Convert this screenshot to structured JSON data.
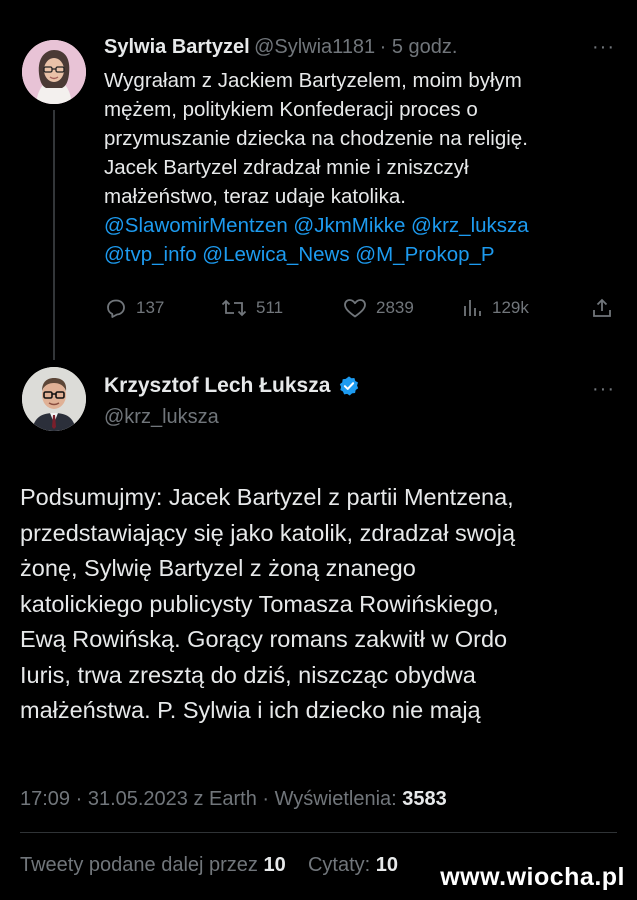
{
  "tweet1": {
    "author_name": "Sylwia Bartyzel",
    "author_handle": "@Sylwia1181",
    "time": "· 5 godz.",
    "more": "···",
    "lines": [
      "Wygrałam z Jackiem Bartyzelem, moim byłym",
      "mężem, politykiem Konfederacji proces o",
      "przymuszanie dziecka na chodzenie na religię.",
      "Jacek Bartyzel zdradzał mnie  i zniszczył",
      "małżeństwo,  teraz udaje katolika."
    ],
    "mention_lines": [
      "@SlawomirMentzen @JkmMikke @krz_luksza",
      "@tvp_info @Lewica_News  @M_Prokop_P"
    ],
    "actions": {
      "replies": "137",
      "retweets": "511",
      "likes": "2839",
      "views": "129k"
    },
    "icons": [
      "reply-icon",
      "retweet-icon",
      "like-icon",
      "views-icon",
      "share-icon"
    ]
  },
  "tweet2": {
    "author_name": "Krzysztof Lech Łuksza",
    "author_handle": "@krz_luksza",
    "more": "···",
    "verified_color": "#1d9bf0",
    "lines": [
      "Podsumujmy: Jacek Bartyzel z partii Mentzena,",
      "przedstawiający się jako katolik, zdradzał swoją",
      "żonę, Sylwię Bartyzel z żoną znanego",
      "katolickiego publicysty Tomasza Rowińskiego,",
      "Ewą Rowińską. Gorący romans zakwitł w Ordo",
      "Iuris, trwa zresztą do dziś, niszcząc obydwa",
      "małżeństwa. P. Sylwia i ich dziecko nie mają"
    ],
    "meta_prefix": "17:09 · 31.05.2023 z Earth · Wyświetlenia:",
    "meta_views": "3583",
    "retweets_label": "Tweety podane dalej przez",
    "retweets_count": "10",
    "quotes_label": "Cytaty:",
    "quotes_count": "10"
  },
  "watermark": "www.wiocha.pl",
  "colors": {
    "background": "#000000",
    "text": "#e7e9ea",
    "muted": "#71767b",
    "accent": "#1d9bf0"
  }
}
